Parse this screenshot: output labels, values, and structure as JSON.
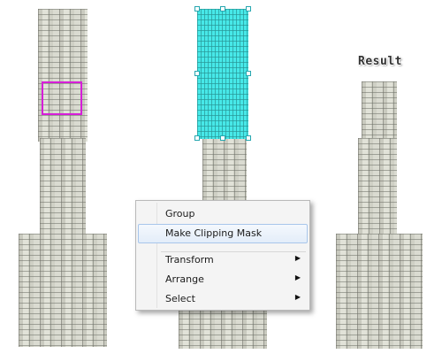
{
  "result_label": "Result",
  "context_menu": {
    "items": [
      {
        "label": "Group",
        "submenu": false,
        "highlighted": false
      },
      {
        "label": "Make Clipping Mask",
        "submenu": false,
        "highlighted": true
      },
      {
        "label": "Transform",
        "submenu": true,
        "highlighted": false
      },
      {
        "label": "Arrange",
        "submenu": true,
        "highlighted": false
      },
      {
        "label": "Select",
        "submenu": true,
        "highlighted": false
      }
    ],
    "submenu_glyph": "▶"
  },
  "colors": {
    "selection": "#47e8e8",
    "mask_rectangle": "#d61ed8",
    "brick": "#d5d6cc"
  }
}
